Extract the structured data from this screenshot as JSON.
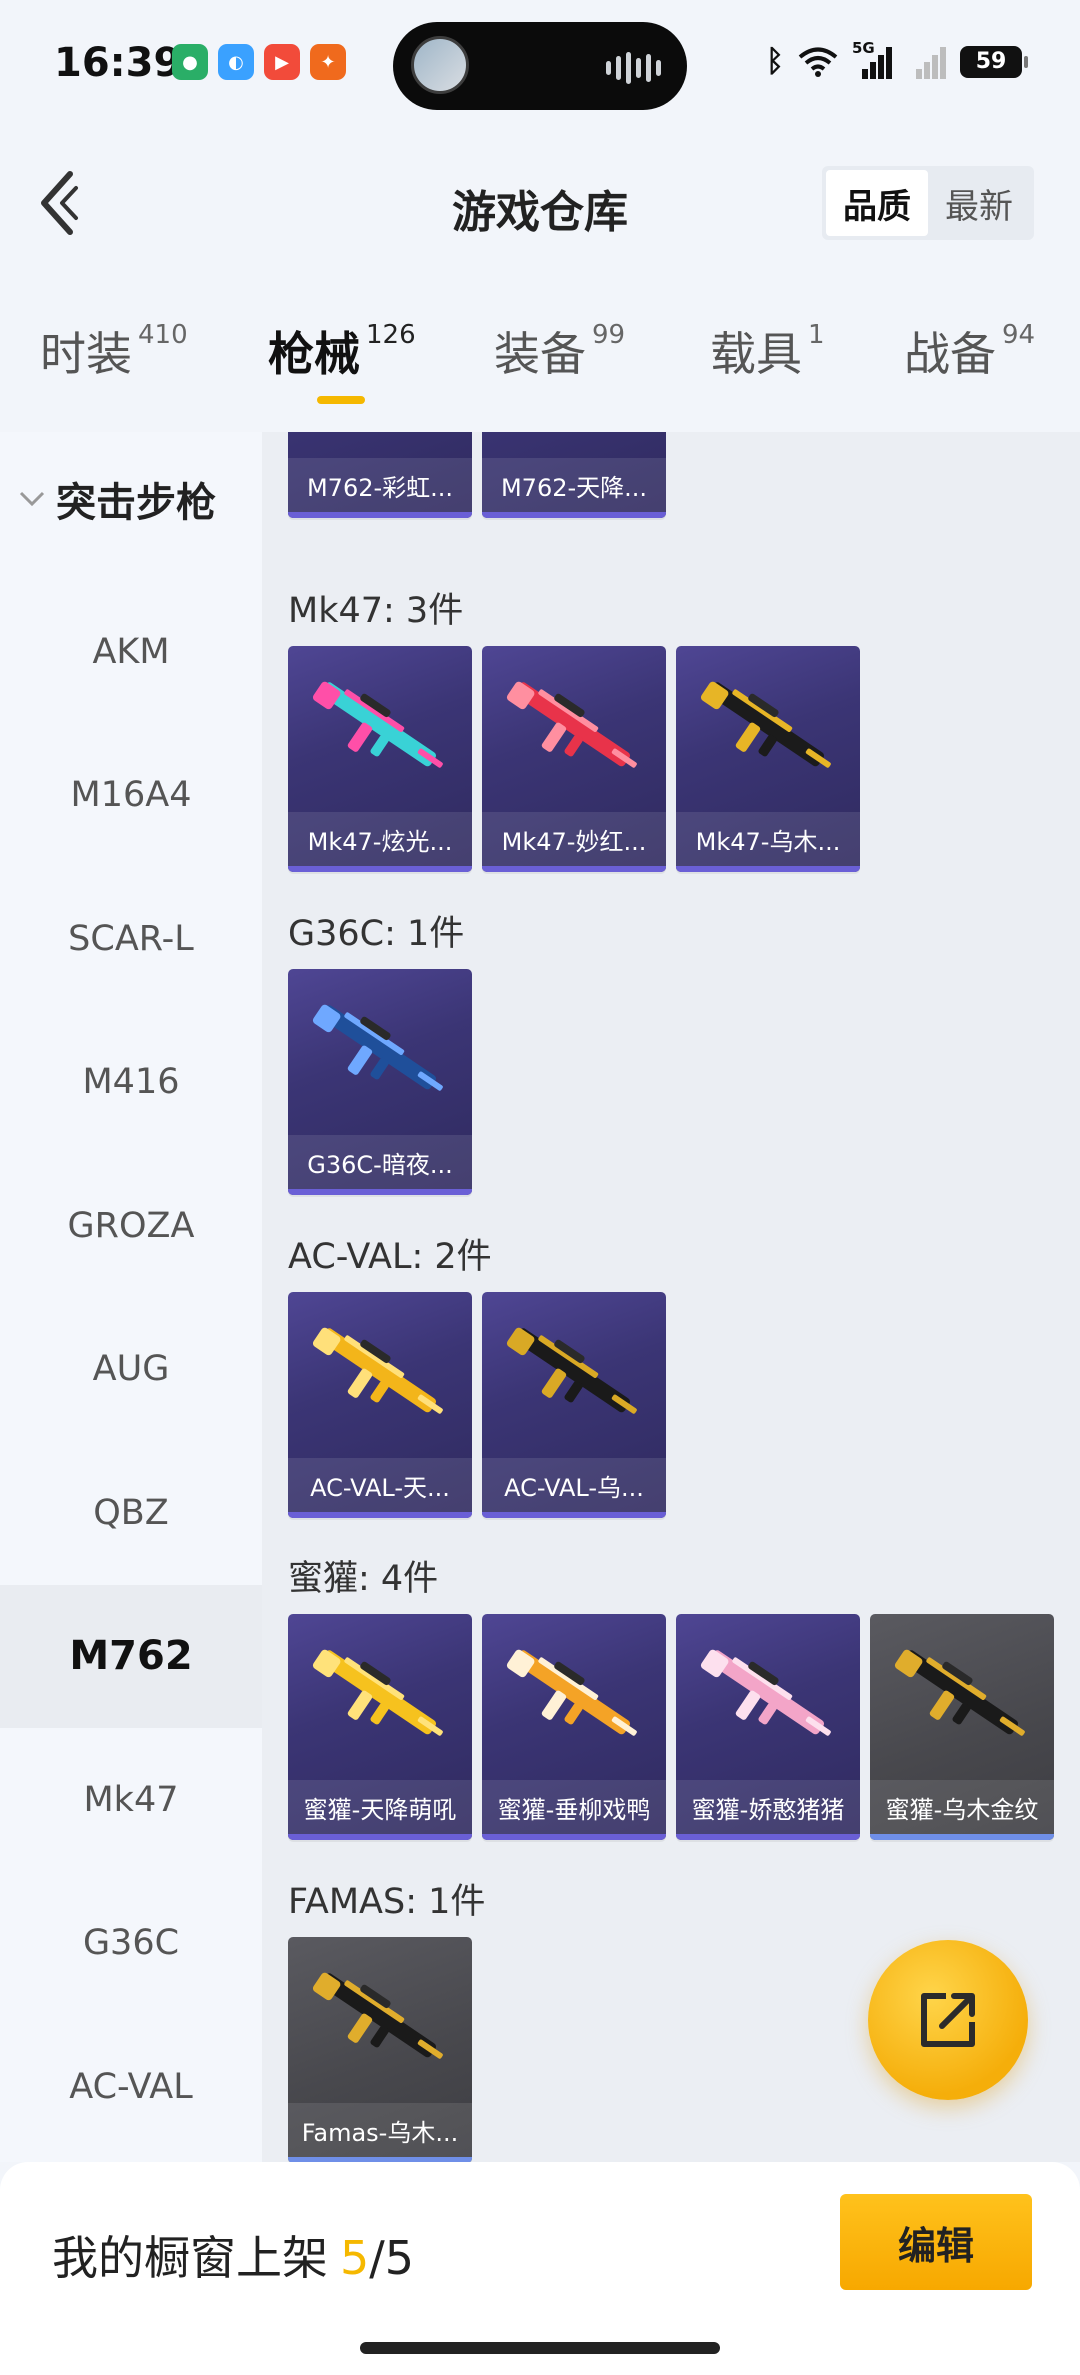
{
  "status_bar": {
    "time": "16:39",
    "battery": "59",
    "network": "5G",
    "apps": [
      "wechat-icon",
      "qq-browser-icon",
      "video-icon",
      "taobao-icon"
    ]
  },
  "header": {
    "title": "游戏仓库",
    "sort_options": [
      {
        "label": "品质",
        "active": true
      },
      {
        "label": "最新",
        "active": false
      }
    ]
  },
  "tabs": [
    {
      "label": "时装",
      "count": "410",
      "active": false
    },
    {
      "label": "枪械",
      "count": "126",
      "active": true
    },
    {
      "label": "装备",
      "count": "99",
      "active": false
    },
    {
      "label": "载具",
      "count": "1",
      "active": false
    },
    {
      "label": "战备",
      "count": "94",
      "active": false
    }
  ],
  "sidebar": {
    "group": "突击步枪",
    "items": [
      {
        "label": "AKM",
        "active": false
      },
      {
        "label": "M16A4",
        "active": false
      },
      {
        "label": "SCAR-L",
        "active": false
      },
      {
        "label": "M416",
        "active": false
      },
      {
        "label": "GROZA",
        "active": false
      },
      {
        "label": "AUG",
        "active": false
      },
      {
        "label": "QBZ",
        "active": false
      },
      {
        "label": "M762",
        "active": true
      },
      {
        "label": "Mk47",
        "active": false
      },
      {
        "label": "G36C",
        "active": false
      },
      {
        "label": "AC-VAL",
        "active": false
      }
    ]
  },
  "sections": [
    {
      "title": "",
      "items": [
        {
          "name": "M762-彩虹...",
          "style": "purple",
          "colors": [
            "#3ea3ff",
            "#ff5fb8"
          ]
        },
        {
          "name": "M762-天降...",
          "style": "purple",
          "colors": [
            "#ffd23a",
            "#f59f00"
          ]
        }
      ]
    },
    {
      "title": "Mk47: 3件",
      "items": [
        {
          "name": "Mk47-炫光...",
          "style": "purple",
          "colors": [
            "#39d2d6",
            "#ff4fa8"
          ]
        },
        {
          "name": "Mk47-妙红...",
          "style": "purple",
          "colors": [
            "#e8334a",
            "#ff8fa0"
          ]
        },
        {
          "name": "Mk47-乌木...",
          "style": "purple",
          "colors": [
            "#1b1b1b",
            "#e7b526"
          ]
        }
      ]
    },
    {
      "title": "G36C: 1件",
      "items": [
        {
          "name": "G36C-暗夜...",
          "style": "purple",
          "colors": [
            "#1f4f9a",
            "#6fa8ff"
          ]
        }
      ]
    },
    {
      "title": "AC-VAL: 2件",
      "items": [
        {
          "name": "AC-VAL-天...",
          "style": "purple",
          "colors": [
            "#f3b51a",
            "#ffe07a"
          ]
        },
        {
          "name": "AC-VAL-乌...",
          "style": "purple",
          "colors": [
            "#1a1a1a",
            "#d9a925"
          ]
        }
      ]
    },
    {
      "title": "蜜獾: 4件",
      "items": [
        {
          "name": "蜜獾-天降萌吼",
          "style": "purple",
          "colors": [
            "#f6c21e",
            "#ffe27a"
          ]
        },
        {
          "name": "蜜獾-垂柳戏鸭",
          "style": "purple",
          "colors": [
            "#f4a326",
            "#fff1d6"
          ]
        },
        {
          "name": "蜜獾-娇憨猪猪",
          "style": "purple",
          "colors": [
            "#f3a5c8",
            "#fde0ee"
          ]
        },
        {
          "name": "蜜獾-乌木金纹",
          "style": "gray",
          "colors": [
            "#1a1a1a",
            "#e0ad2c"
          ]
        }
      ]
    },
    {
      "title": "FAMAS: 1件",
      "items": [
        {
          "name": "Famas-乌木...",
          "style": "gray",
          "colors": [
            "#1a1a1a",
            "#e0ad2c"
          ]
        }
      ]
    }
  ],
  "fab": {
    "icon": "share-export-icon"
  },
  "bottom": {
    "showcase_label": "我的橱窗上架",
    "showcase_current": "5",
    "showcase_total": "/5",
    "edit_label": "编辑"
  },
  "accent_color": "#f5b800"
}
